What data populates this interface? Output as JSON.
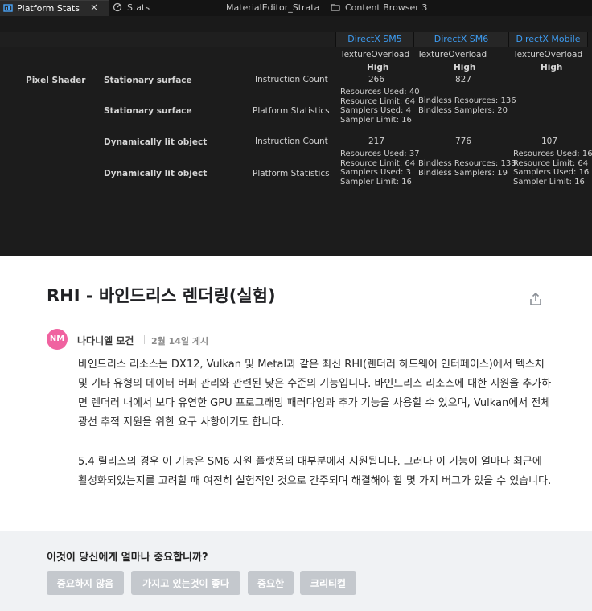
{
  "editor": {
    "tabs": [
      {
        "label": "Platform Stats",
        "active": true
      },
      {
        "label": "Stats"
      },
      {
        "label": "MaterialEditor_Strata"
      },
      {
        "label": "Content Browser 3"
      }
    ],
    "tab_close": "×",
    "columns": [
      "DirectX SM5",
      "DirectX SM6",
      "DirectX  Mobile"
    ],
    "accent_color": "#3d9bf0",
    "subheaders": [
      {
        "overload": "TextureOverload",
        "quality": "High"
      },
      {
        "overload": "TextureOverload",
        "quality": "High"
      },
      {
        "overload": "TextureOverload",
        "quality": "High"
      }
    ],
    "section": "Pixel Shader",
    "rows": [
      {
        "name": "Stationary surface",
        "stat": "Instruction Count",
        "values": [
          [
            "266"
          ],
          [
            "827"
          ],
          []
        ]
      },
      {
        "name": "Stationary surface",
        "stat": "Platform Statistics",
        "values": [
          [
            "Resources Used: 40",
            "Resource Limit: 64",
            "Samplers Used: 4",
            "Sampler Limit: 16"
          ],
          [
            "Bindless Resources: 136",
            "Bindless Samplers: 20"
          ],
          []
        ]
      },
      {
        "name": "Dynamically lit object",
        "stat": "Instruction Count",
        "values": [
          [
            "217"
          ],
          [
            "776"
          ],
          [
            "107"
          ]
        ]
      },
      {
        "name": "Dynamically lit object",
        "stat": "Platform Statistics",
        "values": [
          [
            "Resources Used: 37",
            "Resource Limit: 64",
            "Samplers Used: 3",
            "Sampler Limit: 16"
          ],
          [
            "Bindless Resources: 133",
            "Bindless Samplers: 19"
          ],
          [
            "Resources Used: 16",
            "Resource Limit: 64",
            "Samplers Used: 16",
            "Sampler Limit: 16"
          ]
        ]
      }
    ]
  },
  "article": {
    "title": "RHI - 바인드리스 렌더링(실험)",
    "author_initials": "NM",
    "author": "나다니엘 모건",
    "date": "2월 14일 게시",
    "paragraphs": [
      "바인드리스 리소스는 DX12, Vulkan 및 Metal과 같은 최신 RHI(렌더러 하드웨어 인터페이스)에서 텍스처 및 기타 유형의 데이터 버퍼 관리와 관련된 낮은 수준의 기능입니다. 바인드리스 리소스에 대한 지원을 추가하면 렌더러 내에서 보다 유연한 GPU 프로그래밍 패러다임과 추가 기능을 사용할 수 있으며, Vulkan에서 전체 광선 추적 지원을 위한 요구 사항이기도 합니다.",
      "5.4 릴리스의 경우 이 기능은 SM6 지원 플랫폼의 대부분에서 지원됩니다. 그러나 이 기능이 얼마나 최근에 활성화되었는지를 고려할 때 여전히 실험적인 것으로 간주되며 해결해야 할 몇 가지 버그가 있을 수 있습니다."
    ],
    "avatar_color": "#f062a0"
  },
  "feedback": {
    "question": "이것이 당신에게 얼마나 중요합니까?",
    "buttons": [
      "중요하지 않음",
      "가지고 있는것이 좋다",
      "중요한",
      "크리티컬"
    ]
  }
}
